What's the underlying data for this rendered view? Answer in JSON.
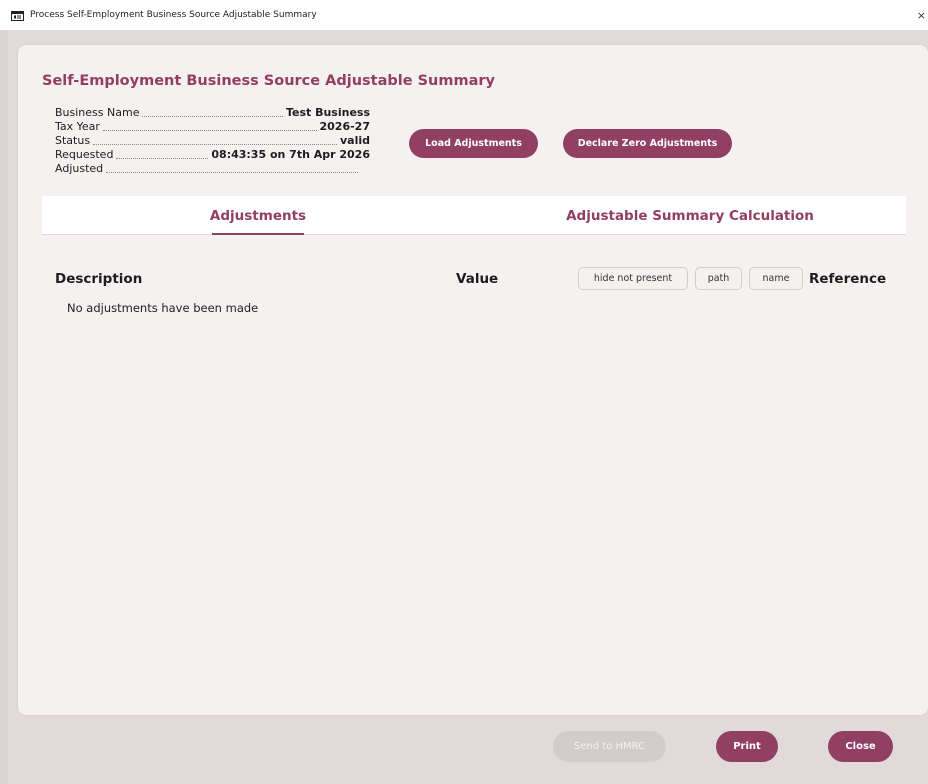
{
  "window": {
    "title": "Process Self-Employment Business Source Adjustable Summary",
    "close_glyph": "×"
  },
  "page": {
    "title": "Self-Employment Business Source Adjustable Summary"
  },
  "info": {
    "business_name_label": "Business Name",
    "business_name_value": "Test Business",
    "tax_year_label": "Tax Year",
    "tax_year_value": "2026-27",
    "status_label": "Status",
    "status_value": "valid",
    "requested_label": "Requested",
    "requested_value": "08:43:35 on 7th Apr 2026",
    "adjusted_label": "Adjusted",
    "adjusted_value": ""
  },
  "actions": {
    "load_label": "Load Adjustments",
    "declare_zero_label": "Declare Zero Adjustments"
  },
  "tabs": [
    {
      "label": "Adjustments",
      "active": true
    },
    {
      "label": "Adjustable Summary Calculation",
      "active": false
    }
  ],
  "table": {
    "description_header": "Description",
    "value_header": "Value",
    "reference_header": "Reference",
    "empty_message": "No adjustments have been made",
    "filters": {
      "hide_not_present": "hide not present",
      "path": "path",
      "name": "name"
    }
  },
  "footer": {
    "send_label": "Send to HMRC",
    "print_label": "Print",
    "close_label": "Close"
  },
  "colors": {
    "accent": "#913f62",
    "panel": "#f5f1f0",
    "background": "#e2dada"
  }
}
